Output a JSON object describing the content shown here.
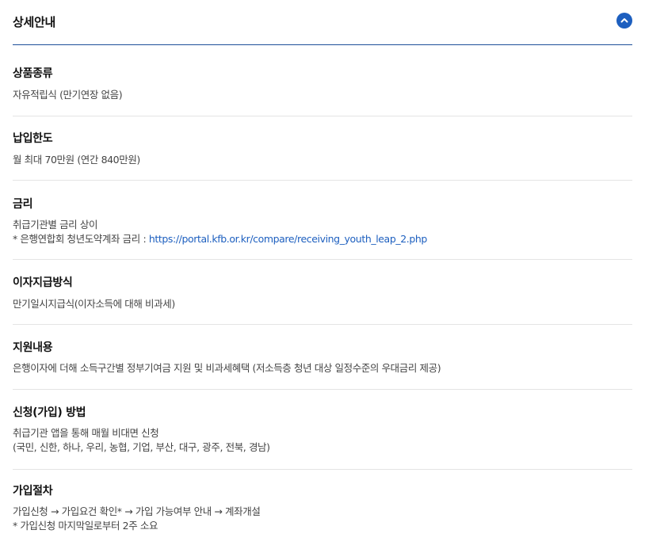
{
  "panel": {
    "title": "상세안내",
    "toggle_icon": "chevron-up-icon",
    "accent": "#1d5fbf"
  },
  "sections": [
    {
      "title": "상품종류",
      "lines": [
        "자유적립식 (만기연장 없음)"
      ]
    },
    {
      "title": "납입한도",
      "lines": [
        "월 최대 70만원 (연간 840만원)"
      ]
    },
    {
      "title": "금리",
      "lines": [
        "취급기관별 금리 상이",
        "* 은행연합회 청년도약계좌 금리 : "
      ],
      "link": "https://portal.kfb.or.kr/compare/receiving_youth_leap_2.php"
    },
    {
      "title": "이자지급방식",
      "lines": [
        "만기일시지급식(이자소득에 대해 비과세)"
      ]
    },
    {
      "title": "지원내용",
      "lines": [
        "은행이자에 더해 소득구간별 정부기여금 지원 및 비과세혜택 (저소득층 청년 대상 일정수준의 우대금리 제공)"
      ]
    },
    {
      "title": "신청(가입) 방법",
      "lines": [
        "취급기관 앱을 통해 매월 비대면 신청",
        "(국민, 신한, 하나, 우리, 농협, 기업, 부산, 대구, 광주, 전북, 경남)"
      ]
    },
    {
      "title": "가입절차",
      "lines": [
        "가입신청 → 가입요건 확인* → 가입 가능여부 안내 → 계좌개설",
        "* 가입신청 마지막일로부터 2주 소요"
      ]
    }
  ]
}
